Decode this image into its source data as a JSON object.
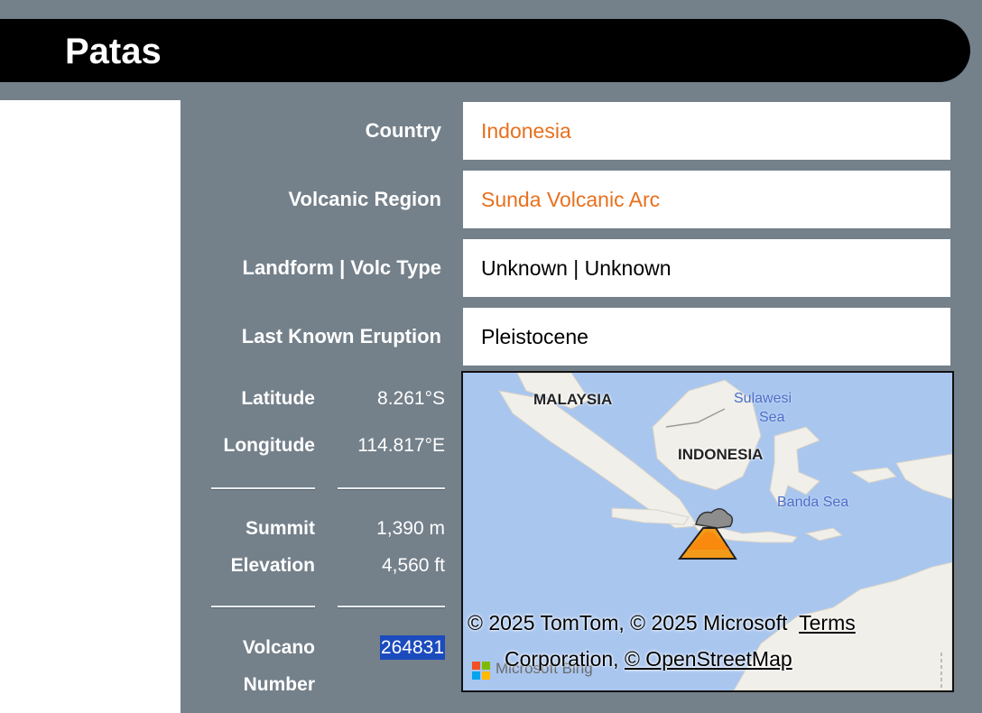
{
  "title": "Patas",
  "rows": [
    {
      "label": "Country",
      "value": "Indonesia"
    },
    {
      "label": "Volcanic Region",
      "value": "Sunda Volcanic Arc"
    },
    {
      "label": "Landform | Volc Type",
      "value": "Unknown | Unknown"
    },
    {
      "label": "Last Known Eruption",
      "value": "Pleistocene"
    }
  ],
  "coords": {
    "latitude_label": "Latitude",
    "latitude_value": "8.261°S",
    "longitude_label": "Longitude",
    "longitude_value": "114.817°E"
  },
  "summit": {
    "label_line1": "Summit",
    "label_line2": "Elevation",
    "meters": "1,390 m",
    "feet": "4,560 ft"
  },
  "volcano_number": {
    "label_line1": "Volcano",
    "label_line2": "Number",
    "value": "264831"
  },
  "map": {
    "labels": {
      "malaysia": "MALAYSIA",
      "indonesia": "INDONESIA",
      "sulawesi_sea_1": "Sulawesi",
      "sulawesi_sea_2": "Sea",
      "banda_sea": "Banda Sea"
    },
    "credit_line1": "© 2025 TomTom, © 2025 Microsoft",
    "terms": "Terms",
    "credit_line2": "Corporation,",
    "osm": "© OpenStreetMap",
    "bing": "Microsoft Bing"
  },
  "colors": {
    "background": "#74808a",
    "link": "#e8701e",
    "highlight": "#1b4bbd"
  }
}
